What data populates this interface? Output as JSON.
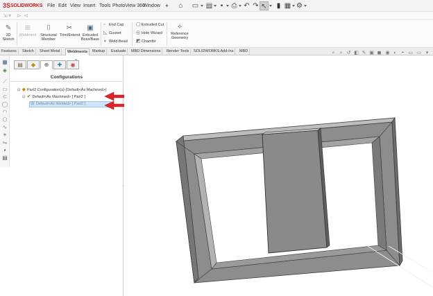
{
  "app": {
    "logo_mark": "3S",
    "logo_text": "SOLIDWORKS",
    "menus": [
      "File",
      "Edit",
      "View",
      "Insert",
      "Tools",
      "PhotoView 360",
      "Window"
    ],
    "pin_icon": "pin-icon"
  },
  "quick_access": [
    {
      "name": "home-icon",
      "glyph": "⌂"
    },
    {
      "name": "new-document-icon",
      "glyph": "▭"
    },
    {
      "name": "open-folder-icon",
      "glyph": "▤"
    },
    {
      "name": "save-icon",
      "glyph": "▪"
    },
    {
      "name": "print-icon",
      "glyph": "⎙"
    },
    {
      "name": "undo-icon",
      "glyph": "↶"
    },
    {
      "name": "redo-icon",
      "glyph": "↷"
    },
    {
      "name": "select-pointer-icon",
      "glyph": "↖"
    },
    {
      "name": "rebuild-traffic-light-icon",
      "glyph": "▮"
    },
    {
      "name": "file-properties-icon",
      "glyph": "▦"
    },
    {
      "name": "options-gear-icon",
      "glyph": "⚙"
    }
  ],
  "ribbon": {
    "buttons": [
      {
        "label": "3D Sketch",
        "icon": "3d-sketch-icon",
        "glyph": "✎",
        "disabled": false
      },
      {
        "label": "Weldment",
        "icon": "weldment-icon",
        "glyph": "⊞",
        "disabled": true
      },
      {
        "label": "Structural Member",
        "icon": "structural-member-icon",
        "glyph": "⌷",
        "disabled": false
      },
      {
        "label": "Trim/Extend",
        "icon": "trim-extend-icon",
        "glyph": "✂",
        "disabled": false
      },
      {
        "label": "Extruded Boss/Base",
        "icon": "extruded-boss-icon",
        "glyph": "▣",
        "disabled": false
      }
    ],
    "small_col1": [
      {
        "label": "End Cap",
        "icon": "end-cap-icon",
        "glyph": "▫"
      },
      {
        "label": "Gusset",
        "icon": "gusset-icon",
        "glyph": "◺"
      },
      {
        "label": "Weld Bead",
        "icon": "weld-bead-icon",
        "glyph": "◖"
      }
    ],
    "small_col2": [
      {
        "label": "Extruded Cut",
        "icon": "extruded-cut-icon",
        "glyph": "▢"
      },
      {
        "label": "Hole Wizard",
        "icon": "hole-wizard-icon",
        "glyph": "◎"
      },
      {
        "label": "Chamfer",
        "icon": "chamfer-icon",
        "glyph": "◩"
      }
    ],
    "reference": {
      "label": "Reference Geometry",
      "icon": "reference-geometry-icon",
      "glyph": "⟡"
    }
  },
  "tabs": [
    "Features",
    "Sketch",
    "Sheet Metal",
    "Weldments",
    "Markup",
    "Evaluate",
    "MBD Dimensions",
    "Render Tools",
    "SOLIDWORKS Add-Ins",
    "MBD"
  ],
  "active_tab": "Weldments",
  "panel": {
    "header": "Configurations",
    "collapse_glyph": "«",
    "tree": {
      "root": "Part2 Configuration(s)  (Default<As Machined>)",
      "child": "Default<As Machined> [ Part2 ]",
      "grandchild": "Default<As Welded> [ Part2 ]"
    }
  },
  "colors": {
    "accent_red": "#d01c1c",
    "arrow_red": "#d9262c",
    "selection": "#cfe4f7",
    "model_face": "#8e8e8e",
    "model_dark": "#5b5b5b"
  }
}
